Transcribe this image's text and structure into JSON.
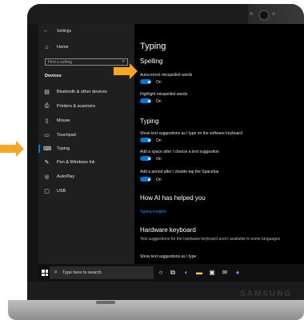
{
  "app_title": "Settings",
  "search_placeholder": "Find a setting",
  "nav": {
    "home": "Home",
    "section": "Devices",
    "items": [
      {
        "label": "Bluetooth & other devices",
        "icon": "bluetooth-devices-icon"
      },
      {
        "label": "Printers & scanners",
        "icon": "printer-icon"
      },
      {
        "label": "Mouse",
        "icon": "mouse-icon"
      },
      {
        "label": "Touchpad",
        "icon": "touchpad-icon"
      },
      {
        "label": "Typing",
        "icon": "keyboard-icon",
        "selected": true
      },
      {
        "label": "Pen & Windows Ink",
        "icon": "pen-icon"
      },
      {
        "label": "AutoPlay",
        "icon": "autoplay-icon"
      },
      {
        "label": "USB",
        "icon": "usb-icon"
      }
    ]
  },
  "content": {
    "title": "Typing",
    "spelling_header": "Spelling",
    "autocorrect_label": "Autocorrect misspelled words",
    "autocorrect_state": "On",
    "highlight_label": "Highlight misspelled words",
    "highlight_state": "On",
    "typing_header": "Typing",
    "suggestions_label": "Show text suggestions as I type on the software keyboard",
    "suggestions_state": "On",
    "space_label": "Add a space after I choose a text suggestion",
    "space_state": "On",
    "period_label": "Add a period after I double-tap the Spacebar",
    "period_state": "On",
    "ai_header": "How AI has helped you",
    "insights_link": "Typing insights",
    "hardware_header": "Hardware keyboard",
    "hardware_desc": "Text suggestions for the hardware keyboard aren't available in some languages",
    "hardware_suggest_label": "Show text suggestions as I type"
  },
  "taskbar": {
    "search_text": "Type here to search"
  },
  "brand": "SAMSUNG",
  "colors": {
    "accent": "#0078d7",
    "arrow": "#f5a623"
  }
}
